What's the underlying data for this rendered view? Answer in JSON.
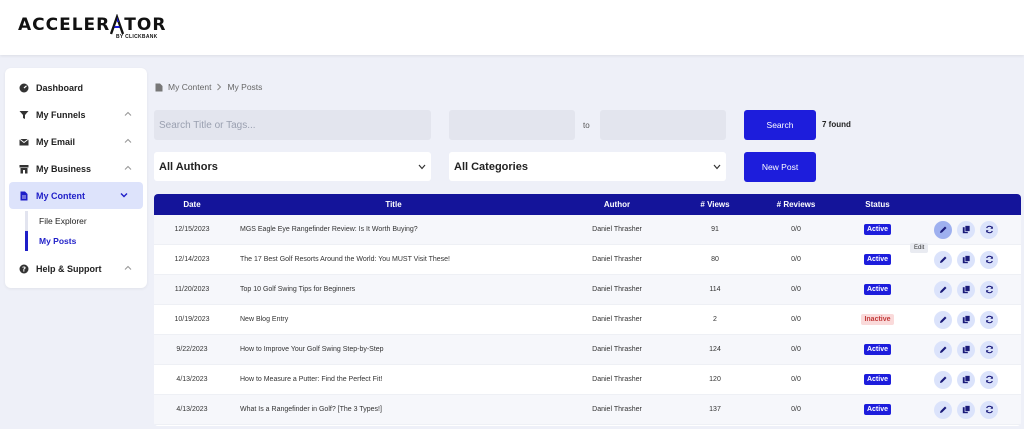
{
  "brand": {
    "name_left": "ACCELER",
    "name_right": "TOR",
    "subline": "BY CLICKBANK",
    "accent": "#1d1ddc"
  },
  "sidebar": {
    "items": [
      {
        "label": "Dashboard",
        "icon": "dashboard-icon",
        "expandable": false
      },
      {
        "label": "My Funnels",
        "icon": "funnel-icon",
        "expandable": true
      },
      {
        "label": "My Email",
        "icon": "mail-icon",
        "expandable": true
      },
      {
        "label": "My Business",
        "icon": "store-icon",
        "expandable": true
      },
      {
        "label": "My Content",
        "icon": "document-icon",
        "expandable": true,
        "active": true
      },
      {
        "label": "Help & Support",
        "icon": "help-icon",
        "expandable": true
      }
    ],
    "sub_items": [
      {
        "label": "File Explorer"
      },
      {
        "label": "My Posts",
        "active": true
      }
    ]
  },
  "breadcrumb": {
    "parent": "My Content",
    "current": "My Posts"
  },
  "filters": {
    "search_placeholder": "Search Title or Tags...",
    "date_from_value": "",
    "date_to_value": "",
    "to_label": "to",
    "search_button": "Search",
    "found_text": "7 found",
    "authors_selected": "All Authors",
    "categories_selected": "All Categories",
    "new_post_button": "New Post"
  },
  "table": {
    "headers": {
      "date": "Date",
      "title": "Title",
      "author": "Author",
      "views": "# Views",
      "reviews": "# Reviews",
      "status": "Status"
    },
    "rows": [
      {
        "date": "12/15/2023",
        "title": "MGS Eagle Eye Rangefinder Review: Is It Worth Buying?",
        "author": "Daniel Thrasher",
        "views": "91",
        "reviews": "0/0",
        "status": "Active"
      },
      {
        "date": "12/14/2023",
        "title": "The 17 Best Golf Resorts Around the World: You MUST Visit These!",
        "author": "Daniel Thrasher",
        "views": "80",
        "reviews": "0/0",
        "status": "Active"
      },
      {
        "date": "11/20/2023",
        "title": "Top 10 Golf Swing Tips for Beginners",
        "author": "Daniel Thrasher",
        "views": "114",
        "reviews": "0/0",
        "status": "Active"
      },
      {
        "date": "10/19/2023",
        "title": "New Blog Entry",
        "author": "Daniel Thrasher",
        "views": "2",
        "reviews": "0/0",
        "status": "Inactive"
      },
      {
        "date": "9/22/2023",
        "title": "How to Improve Your Golf Swing Step-by-Step",
        "author": "Daniel Thrasher",
        "views": "124",
        "reviews": "0/0",
        "status": "Active"
      },
      {
        "date": "4/13/2023",
        "title": "How to Measure a Putter: Find the Perfect Fit!",
        "author": "Daniel Thrasher",
        "views": "120",
        "reviews": "0/0",
        "status": "Active"
      },
      {
        "date": "4/13/2023",
        "title": "What Is a Rangefinder in Golf? [The 3 Types!]",
        "author": "Daniel Thrasher",
        "views": "137",
        "reviews": "0/0",
        "status": "Active"
      }
    ],
    "action_icons": [
      "pencil-icon",
      "copy-icon",
      "refresh-icon"
    ],
    "tooltip": "Edit"
  },
  "colors": {
    "header_bg": "#14149a",
    "primary": "#1d1ddc",
    "inactive_bg": "#fadada",
    "inactive_text": "#c23b3b"
  }
}
